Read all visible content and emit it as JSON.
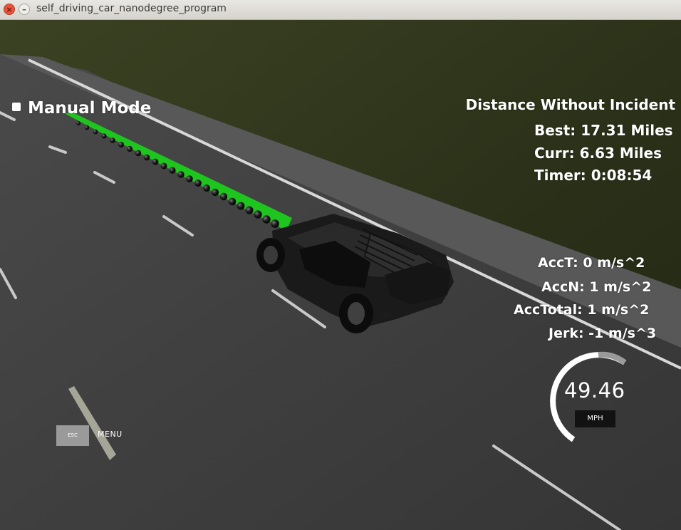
{
  "window": {
    "title": "self_driving_car_nanodegree_program",
    "close_glyph": "×",
    "minimize_glyph": "–"
  },
  "hud": {
    "manual_mode_label": "Manual Mode",
    "distance_title": "Distance Without Incident",
    "best": "Best: 17.31 Miles",
    "curr": "Curr: 6.63 Miles",
    "timer": "Timer: 0:08:54",
    "acc_t": "AccT: 0 m/s^2",
    "acc_n": "AccN: 1 m/s^2",
    "acc_total": "AccTotal: 1 m/s^2",
    "jerk": "Jerk: -1 m/s^3"
  },
  "speedometer": {
    "value": "49.46",
    "unit": "MPH"
  },
  "controls": {
    "esc_label": "ESC",
    "menu_label": "MENU"
  },
  "colors": {
    "path_green": "#1ec51e",
    "road": "#3a3a3a",
    "grass": "#2f3a1a",
    "hud_text": "#ffffff"
  }
}
